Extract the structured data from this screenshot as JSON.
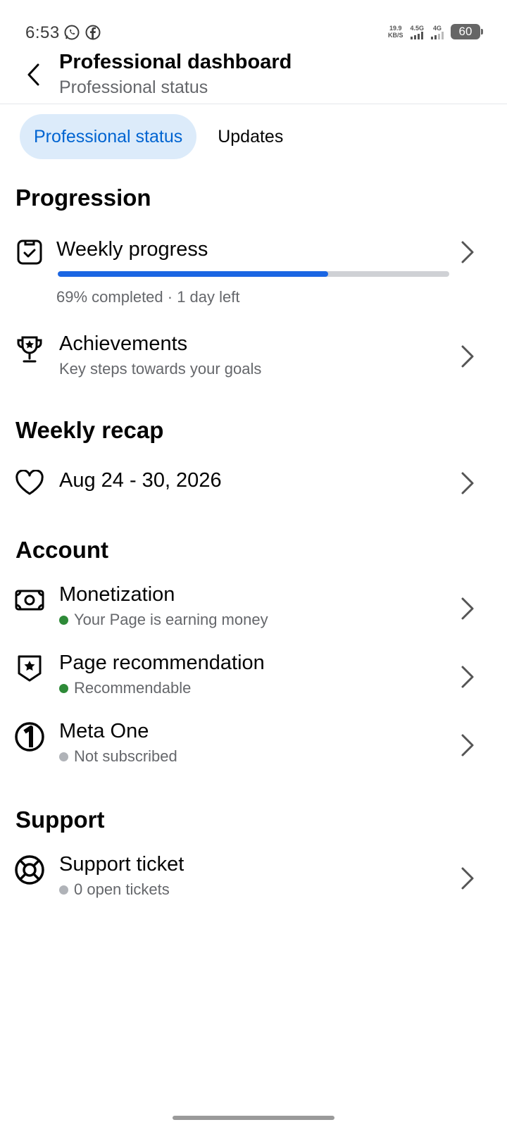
{
  "status_bar": {
    "time": "6:53",
    "net_speed_value": "19.9",
    "net_speed_unit": "KB/S",
    "net1_label": "4.5G",
    "net2_label": "4G",
    "battery": "60"
  },
  "header": {
    "title": "Professional dashboard",
    "subtitle": "Professional status"
  },
  "tabs": [
    {
      "label": "Professional status",
      "active": true
    },
    {
      "label": "Updates",
      "active": false
    }
  ],
  "progression": {
    "heading": "Progression",
    "weekly_progress": {
      "title": "Weekly progress",
      "percent": 69,
      "caption": "69% completed · 1 day left"
    },
    "achievements": {
      "title": "Achievements",
      "subtitle": "Key steps towards your goals"
    }
  },
  "weekly_recap": {
    "heading": "Weekly recap",
    "item": {
      "title": "Aug 24 - 30, 2026"
    }
  },
  "account": {
    "heading": "Account",
    "monetization": {
      "title": "Monetization",
      "status": "Your Page is earning money",
      "status_color": "#2e8a38"
    },
    "page_recommendation": {
      "title": "Page recommendation",
      "status": "Recommendable",
      "status_color": "#2e8a38"
    },
    "meta_one": {
      "title": "Meta One",
      "status": "Not subscribed",
      "status_color": "#b0b3b8"
    }
  },
  "support": {
    "heading": "Support",
    "support_ticket": {
      "title": "Support ticket",
      "status": "0 open tickets",
      "status_color": "#b0b3b8"
    }
  },
  "colors": {
    "accent": "#0064d1",
    "active_tab_bg": "#dcebfa",
    "progress_fill": "#1b66e3",
    "progress_track": "#cfd1d5"
  }
}
